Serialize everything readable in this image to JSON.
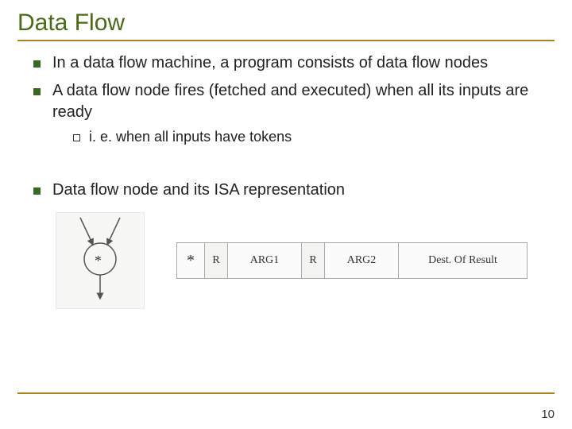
{
  "title": "Data Flow",
  "bullets": [
    "In a data flow machine, a program consists of data flow nodes",
    "A data flow node fires (fetched and executed) when all its inputs are ready"
  ],
  "sub_bullet": "i. e. when all inputs have tokens",
  "bullet3": "Data flow node and its ISA representation",
  "node_op": "*",
  "isa": {
    "op": "*",
    "r1": "R",
    "arg1": "ARG1",
    "r2": "R",
    "arg2": "ARG2",
    "dest": "Dest. Of Result"
  },
  "page_number": "10"
}
